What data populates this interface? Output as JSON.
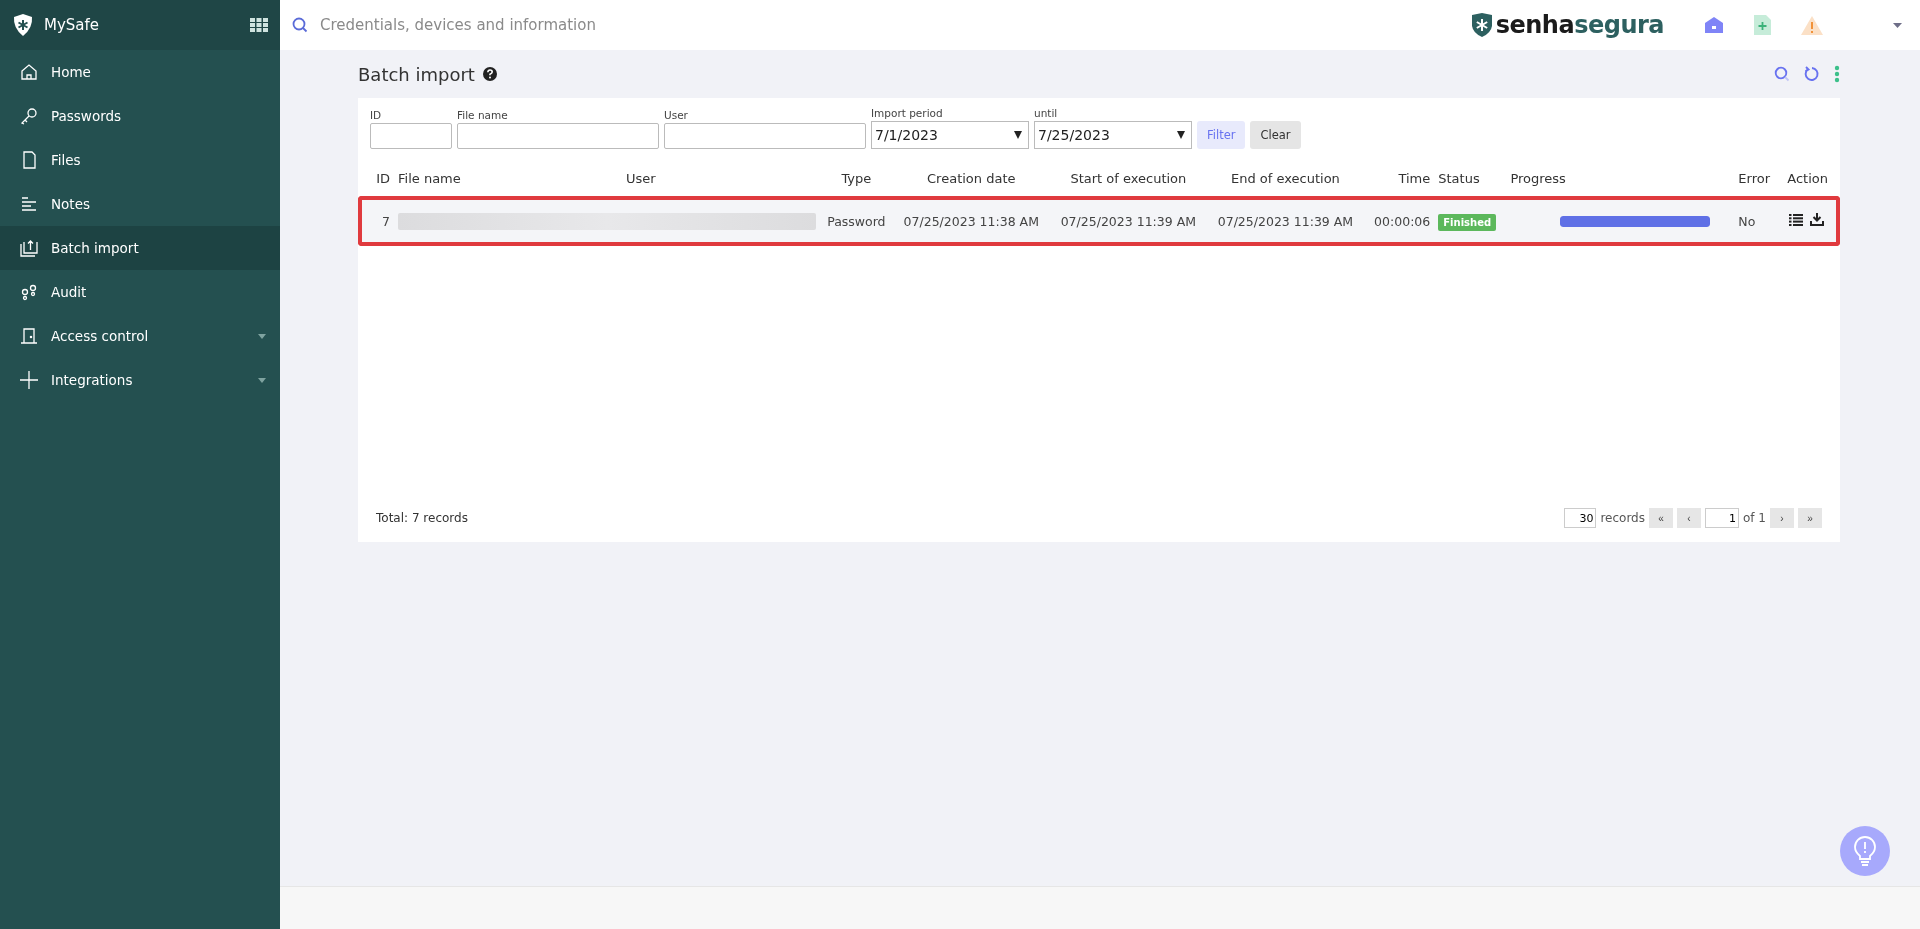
{
  "sidebar": {
    "title": "MySafe",
    "items": [
      {
        "label": "Home",
        "selected": false,
        "expandable": false
      },
      {
        "label": "Passwords",
        "selected": false,
        "expandable": false
      },
      {
        "label": "Files",
        "selected": false,
        "expandable": false
      },
      {
        "label": "Notes",
        "selected": false,
        "expandable": false
      },
      {
        "label": "Batch import",
        "selected": true,
        "expandable": false
      },
      {
        "label": "Audit",
        "selected": false,
        "expandable": false
      },
      {
        "label": "Access control",
        "selected": false,
        "expandable": true
      },
      {
        "label": "Integrations",
        "selected": false,
        "expandable": true
      }
    ]
  },
  "header": {
    "search": {
      "placeholder": "Credentials, devices and information"
    },
    "brand": {
      "lead": "senha",
      "tail": "segura"
    }
  },
  "page": {
    "title": "Batch import"
  },
  "filters": [
    {
      "label": "ID",
      "kind": "text"
    },
    {
      "label": "File name",
      "kind": "text"
    },
    {
      "label": "User",
      "kind": "text"
    },
    {
      "label": "Import period",
      "kind": "date",
      "value": "7/1/2023"
    },
    {
      "label": "until",
      "kind": "date",
      "value": "7/25/2023"
    }
  ],
  "filter_buttons": [
    {
      "label": "Filter",
      "kind": "primary"
    },
    {
      "label": "Clear",
      "kind": "secondary"
    }
  ],
  "table": {
    "columns": [
      "ID",
      "File name",
      "User",
      "Type",
      "Creation date",
      "Start of execution",
      "End of execution",
      "Time",
      "Status",
      "Progress",
      "Error",
      "Action"
    ],
    "rows": [
      {
        "id": "7",
        "redacted": true,
        "type": "Password",
        "created": "07/25/2023 11:38 AM",
        "started": "07/25/2023 11:39 AM",
        "ended": "07/25/2023 11:39 AM",
        "time": "00:00:06",
        "status": "Finished",
        "level": 1,
        "error": "No",
        "highlighted": true
      }
    ]
  },
  "footer": {
    "total": "Total: 7 records",
    "page_size": "30",
    "records_label": "records",
    "first": "«",
    "prev": "‹",
    "page": "1",
    "of": "of 1",
    "next": "›",
    "last": "»"
  }
}
